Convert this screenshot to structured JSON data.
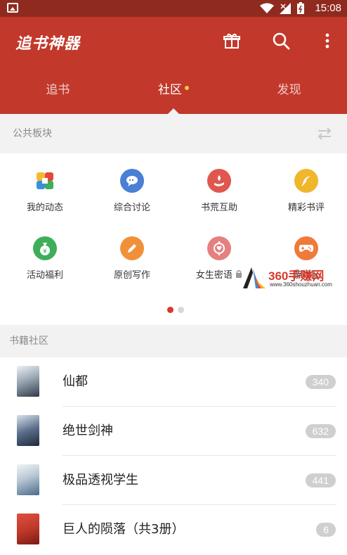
{
  "status_bar": {
    "time": "15:08"
  },
  "app_bar": {
    "title": "追书神器",
    "icons": [
      "gift-icon",
      "search-icon",
      "more-vertical-icon"
    ],
    "tabs": [
      {
        "label": "追书",
        "active": false
      },
      {
        "label": "社区",
        "active": true,
        "badge": true
      },
      {
        "label": "发现",
        "active": false
      }
    ]
  },
  "public_section": {
    "title": "公共板块",
    "items": [
      {
        "label": "我的动态",
        "icon": "pinwheel-icon",
        "color": "#ffffff"
      },
      {
        "label": "综合讨论",
        "icon": "chat-icon",
        "color": "#4a7fd6"
      },
      {
        "label": "书荒互助",
        "icon": "help-hand-icon",
        "color": "#e0574f"
      },
      {
        "label": "精彩书评",
        "icon": "feather-icon",
        "color": "#f0b62c"
      },
      {
        "label": "活动福利",
        "icon": "money-bag-icon",
        "color": "#3fae5a"
      },
      {
        "label": "原创写作",
        "icon": "pencil-icon",
        "color": "#f0913a"
      },
      {
        "label": "女生密语",
        "icon": "heart-target-icon",
        "color": "#e58080"
      },
      {
        "label": "游戏区",
        "icon": "gamepad-icon",
        "color": "#f07a3a"
      }
    ],
    "page_count": 2,
    "current_page": 1
  },
  "watermark": {
    "text": "360手赚网",
    "url": "www.360shouzhuan.com"
  },
  "book_section": {
    "title": "书籍社区",
    "books": [
      {
        "title": "仙都",
        "count": "340",
        "cover_color": "#3a4a5a"
      },
      {
        "title": "绝世剑神",
        "count": "632",
        "cover_color": "#5a6e8a"
      },
      {
        "title": "极品透视学生",
        "count": "441",
        "cover_color": "#8aa0b4"
      },
      {
        "title": "巨人的陨落（共3册）",
        "count": "6",
        "cover_color": "#c0392b"
      }
    ]
  }
}
